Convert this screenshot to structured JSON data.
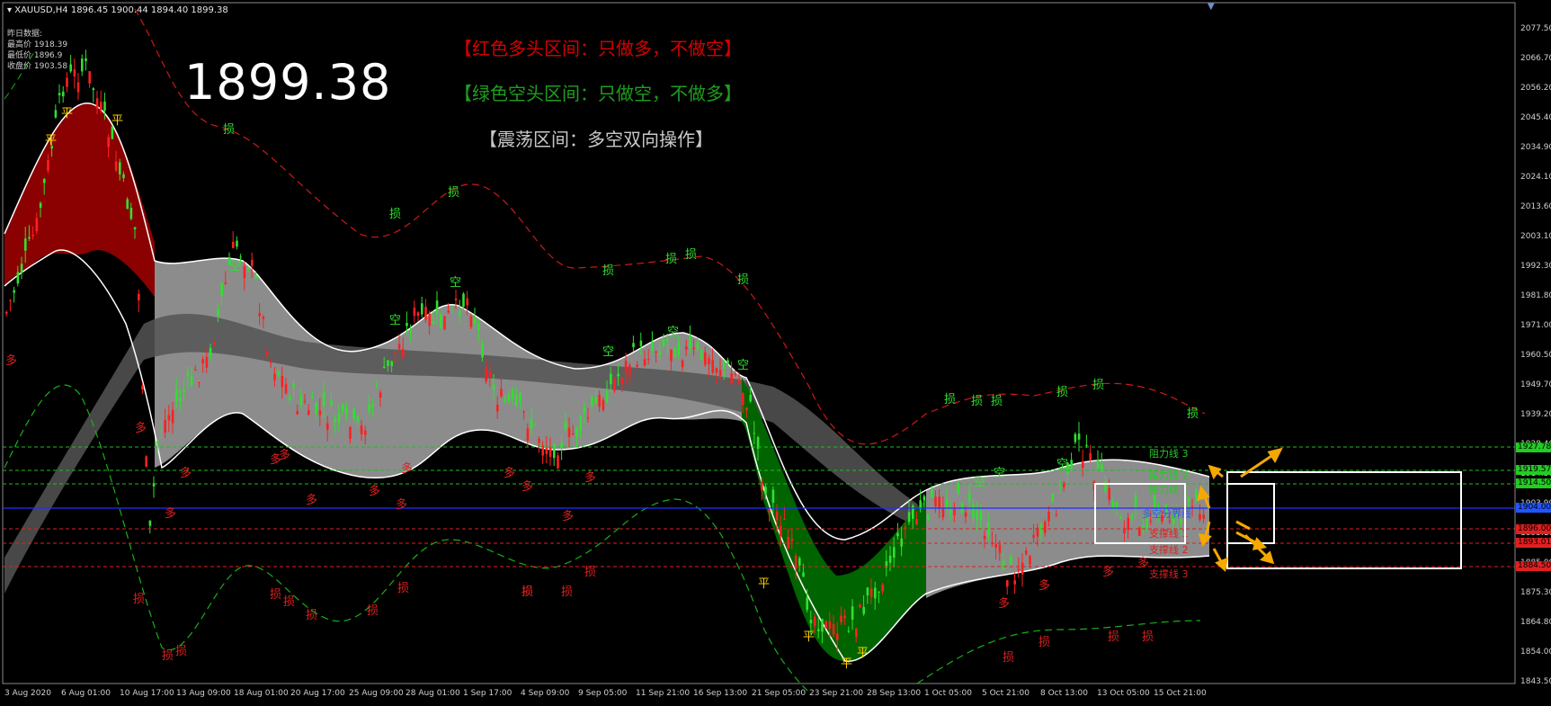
{
  "symbol_header": "XAUUSD,H4  1896.45 1900.44 1894.40 1899.38",
  "prev_day": {
    "title": "昨日数据:",
    "high": "最高价 1918.39",
    "low": "最低价 1896.9",
    "close": "收盘价 1903.58"
  },
  "current_price": "1899.38",
  "legend": {
    "red_zone": "【红色多头区间：只做多，不做空】",
    "green_zone": "【绿色空头区间：只做空，不做多】",
    "range_zone": "【震荡区间：多空双向操作】"
  },
  "level_labels": {
    "resistance3": "阻力线 3",
    "resistance2": "阻力线 2",
    "resistance1": "阻力线 1",
    "divider": "多空分界线",
    "support1": "支撑线 1",
    "support2": "支撑线 2",
    "support3": "支撑线 3"
  },
  "price_axis": [
    "2077.50",
    "2066.70",
    "2056.20",
    "2045.40",
    "2034.90",
    "2024.10",
    "2013.60",
    "2003.10",
    "1992.30",
    "1981.80",
    "1971.00",
    "1960.50",
    "1949.70",
    "1939.20",
    "1928.40",
    "1914.50",
    "1903.90",
    "1893.10",
    "1885.00",
    "1875.30",
    "1864.80",
    "1854.00",
    "1843.50"
  ],
  "price_tags": [
    {
      "text": "1927.78",
      "color": "#22cc22"
    },
    {
      "text": "1919.57",
      "color": "#22cc22"
    },
    {
      "text": "1914.50",
      "color": "#22cc22"
    },
    {
      "text": "1904.00",
      "color": "#2255ff"
    },
    {
      "text": "1896.00",
      "color": "#e02020"
    },
    {
      "text": "1893.01",
      "color": "#e02020"
    },
    {
      "text": "1884.50",
      "color": "#e02020"
    }
  ],
  "time_axis": [
    "3 Aug 2020",
    "6 Aug 01:00",
    "10 Aug 17:00",
    "13 Aug 09:00",
    "18 Aug 01:00",
    "20 Aug 17:00",
    "25 Aug 09:00",
    "28 Aug 01:00",
    "1 Sep 17:00",
    "4 Sep 09:00",
    "9 Sep 05:00",
    "11 Sep 21:00",
    "16 Sep 13:00",
    "21 Sep 05:00",
    "23 Sep 21:00",
    "28 Sep 13:00",
    "1 Oct 05:00",
    "5 Oct 21:00",
    "8 Oct 13:00",
    "13 Oct 05:00",
    "15 Oct 21:00"
  ],
  "markers": {
    "long": "多",
    "short": "空",
    "flat": "平",
    "stop": "损"
  },
  "colors": {
    "bull_zone": "#8b0000",
    "bear_zone": "#006400",
    "range_zone": "#8c8c8c",
    "up_candle": "#ff2020",
    "down_candle": "#30e030",
    "divider_line": "#2030ff",
    "arrow": "#f5a800"
  }
}
